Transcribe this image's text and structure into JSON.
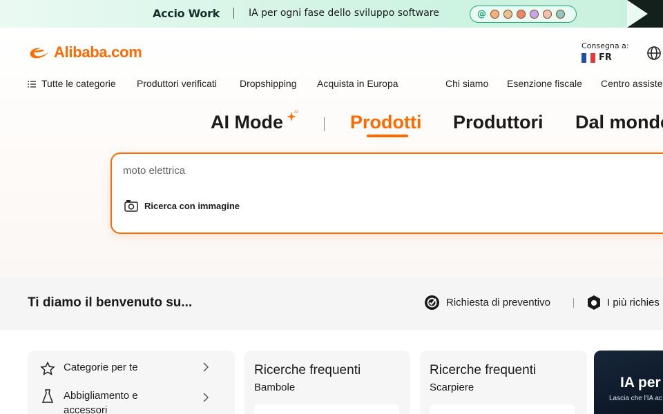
{
  "promo": {
    "brand": "Accio Work",
    "text": "IA per ogni fase dello sviluppo software",
    "at_symbol": "@"
  },
  "header": {
    "logo_text": "Alibaba.com",
    "deliver_label": "Consegna a:",
    "country_code": "FR",
    "globe_icon": "globe-icon"
  },
  "nav": {
    "all_categories": "Tutte le categorie",
    "items": [
      "Produttori verificati",
      "Dropshipping",
      "Acquista in Europa"
    ],
    "right_items": [
      "Chi siamo",
      "Esenzione fiscale",
      "Centro assiste"
    ]
  },
  "tabs": {
    "ai_mode": "AI Mode",
    "ai_badge": "AI",
    "products": "Prodotti",
    "manufacturers": "Produttori",
    "worldwide": "Dal mondo"
  },
  "search": {
    "placeholder": "moto elettrica",
    "image_search": "Ricerca con immagine"
  },
  "welcome": {
    "title": "Ti diamo il benvenuto su...",
    "quote_request": "Richiesta di preventivo",
    "most_requested": "I più richies"
  },
  "categories_card": {
    "for_you": "Categorie per te",
    "clothing_line1": "Abbigliamento e",
    "clothing_line2": "accessori"
  },
  "frequent_searches": [
    {
      "title": "Ricerche frequenti",
      "subtitle": "Bambole"
    },
    {
      "title": "Ricerche frequenti",
      "subtitle": "Scarpiere"
    }
  ],
  "ai_card": {
    "title": "IA per",
    "subtitle": "Lascia che l'IA ac"
  },
  "colors": {
    "brand_orange": "#ff6a00",
    "promo_green": "#19a97b"
  }
}
